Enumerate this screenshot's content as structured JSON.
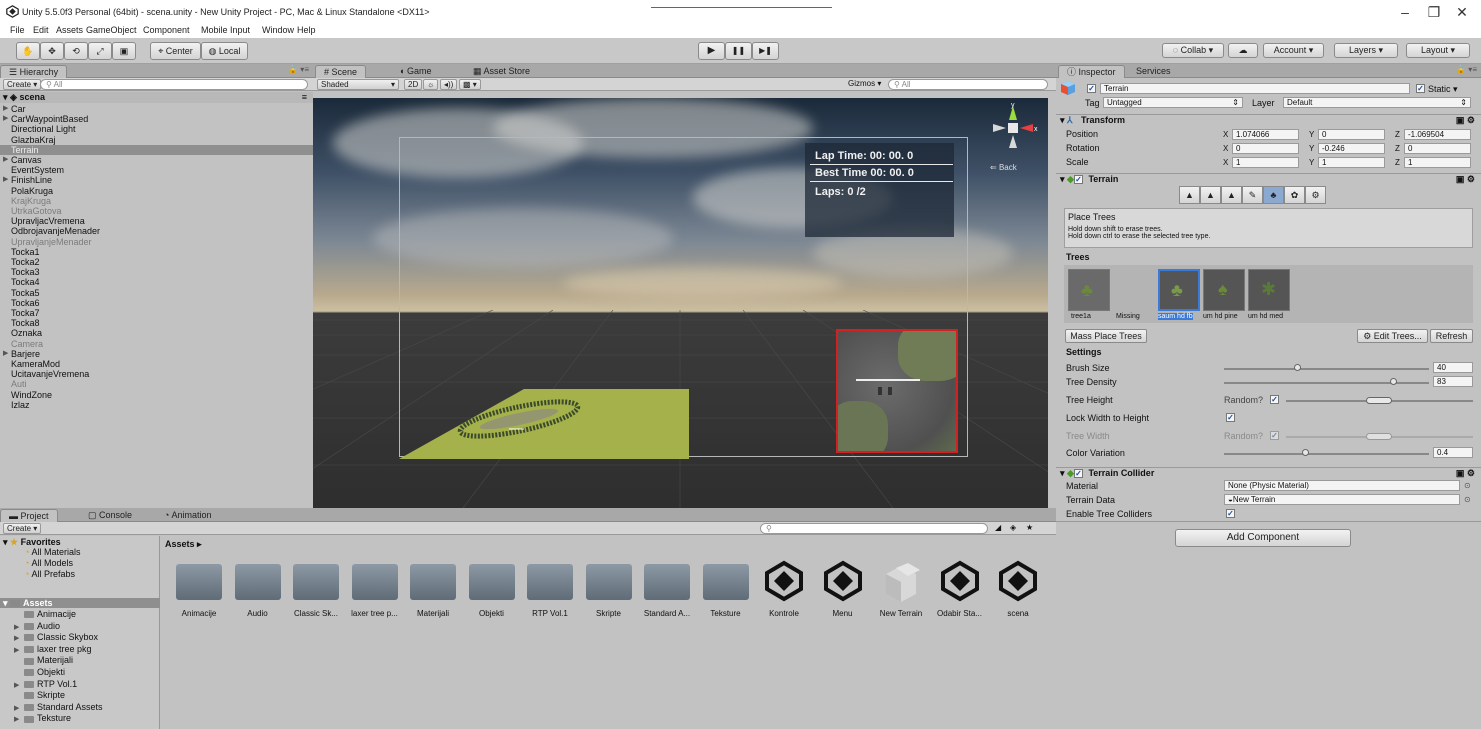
{
  "window": {
    "title": "Unity 5.5.0f3 Personal (64bit) - scena.unity - New Unity Project - PC, Mac & Linux Standalone <DX11>",
    "minimize": "–",
    "maximize": "❐",
    "close": "✕"
  },
  "menu": [
    "File",
    "Edit",
    "Assets",
    "GameObject",
    "Component",
    "Mobile Input",
    "Window",
    "Help"
  ],
  "toolbar": {
    "tools": [
      "✋",
      "✥",
      "⟲",
      "⤢",
      "▣"
    ],
    "pivot": "Center",
    "space": "Local",
    "play": "▶",
    "pause": "❚❚",
    "step": "▶❚",
    "collab": "Collab",
    "cloud": "☁",
    "account": "Account",
    "layers": "Layers",
    "layout": "Layout"
  },
  "hierarchy": {
    "tab": "Hierarchy",
    "create": "Create",
    "search_placeholder": "All",
    "scene": "scena",
    "items": [
      {
        "label": "Car",
        "arrow": true,
        "grey": false
      },
      {
        "label": "CarWaypointBased",
        "arrow": true,
        "grey": false
      },
      {
        "label": "Directional Light",
        "arrow": false,
        "grey": false
      },
      {
        "label": "GlazbaKraj",
        "arrow": false,
        "grey": false
      },
      {
        "label": "Terrain",
        "arrow": false,
        "grey": false,
        "selected": true
      },
      {
        "label": "Canvas",
        "arrow": true,
        "grey": false
      },
      {
        "label": "EventSystem",
        "arrow": false,
        "grey": false
      },
      {
        "label": "FinishLine",
        "arrow": true,
        "grey": false
      },
      {
        "label": "PolaKruga",
        "arrow": false,
        "grey": false
      },
      {
        "label": "KrajKruga",
        "arrow": false,
        "grey": true
      },
      {
        "label": "UtrkaGotova",
        "arrow": false,
        "grey": true
      },
      {
        "label": "UpravljacVremena",
        "arrow": false,
        "grey": false
      },
      {
        "label": "OdbrojavanjeMenader",
        "arrow": false,
        "grey": false
      },
      {
        "label": "UpravljanjeMenader",
        "arrow": false,
        "grey": true
      },
      {
        "label": "Tocka1",
        "arrow": false,
        "grey": false
      },
      {
        "label": "Tocka2",
        "arrow": false,
        "grey": false
      },
      {
        "label": "Tocka3",
        "arrow": false,
        "grey": false
      },
      {
        "label": "Tocka4",
        "arrow": false,
        "grey": false
      },
      {
        "label": "Tocka5",
        "arrow": false,
        "grey": false
      },
      {
        "label": "Tocka6",
        "arrow": false,
        "grey": false
      },
      {
        "label": "Tocka7",
        "arrow": false,
        "grey": false
      },
      {
        "label": "Tocka8",
        "arrow": false,
        "grey": false
      },
      {
        "label": "Oznaka",
        "arrow": false,
        "grey": false
      },
      {
        "label": "Camera",
        "arrow": false,
        "grey": true
      },
      {
        "label": "Barjere",
        "arrow": true,
        "grey": false
      },
      {
        "label": "KameraMod",
        "arrow": false,
        "grey": false
      },
      {
        "label": "UcitavanjeVremena",
        "arrow": false,
        "grey": false
      },
      {
        "label": "Auti",
        "arrow": false,
        "grey": true
      },
      {
        "label": "WindZone",
        "arrow": false,
        "grey": false
      },
      {
        "label": "Izlaz",
        "arrow": false,
        "grey": false
      }
    ]
  },
  "scene_tabs": {
    "scene": "Scene",
    "game": "Game",
    "asset_store": "Asset Store",
    "shaded": "Shaded",
    "mode2d": "2D",
    "gizmos": "Gizmos",
    "search_placeholder": "All",
    "back": "Back",
    "y_axis": "y",
    "x_axis": "x"
  },
  "hud": {
    "lap_time": "Lap Time:  00: 00. 0",
    "best_time": "Best Time  00: 00. 0",
    "laps": "Laps:   0 /2"
  },
  "inspector": {
    "tab": "Inspector",
    "services_tab": "Services",
    "object_name": "Terrain",
    "static_label": "Static",
    "tag_label": "Tag",
    "tag_value": "Untagged",
    "layer_label": "Layer",
    "layer_value": "Default",
    "transform": {
      "title": "Transform",
      "position_label": "Position",
      "rotation_label": "Rotation",
      "scale_label": "Scale",
      "position": {
        "x": "1.074066",
        "y": "0",
        "z": "-1.069504"
      },
      "rotation": {
        "x": "0",
        "y": "-0.246",
        "z": "0"
      },
      "scale": {
        "x": "1",
        "y": "1",
        "z": "1"
      }
    },
    "terrain": {
      "title": "Terrain",
      "help_title": "Place Trees",
      "help_line1": "Hold down shift to erase trees.",
      "help_line2": "Hold down ctrl to erase the selected tree type.",
      "trees_heading": "Trees",
      "tree_labels": [
        "tree1a",
        "Missing",
        "saum hd fb",
        "um hd pine",
        "um hd med"
      ],
      "mass_place": "Mass Place Trees",
      "edit_trees": "Edit Trees...",
      "refresh": "Refresh",
      "settings_heading": "Settings",
      "brush_size_label": "Brush Size",
      "brush_size": "40",
      "brush_size_fraction": 0.36,
      "density_label": "Tree Density",
      "density": "83",
      "density_fraction": 0.83,
      "height_label": "Tree Height",
      "random_label": "Random?",
      "lock_label": "Lock Width to Height",
      "width_label": "Tree Width",
      "color_var_label": "Color Variation",
      "color_var": "0.4",
      "color_var_fraction": 0.4
    },
    "collider": {
      "title": "Terrain Collider",
      "material_label": "Material",
      "material_value": "None (Physic Material)",
      "data_label": "Terrain Data",
      "data_value": "New Terrain",
      "enable_label": "Enable Tree Colliders"
    },
    "add_component": "Add Component"
  },
  "project": {
    "tab_project": "Project",
    "tab_console": "Console",
    "tab_animation": "Animation",
    "create": "Create",
    "favorites": "Favorites",
    "fav_items": [
      "All Materials",
      "All Models",
      "All Prefabs"
    ],
    "assets_root": "Assets",
    "breadcrumb": "Assets",
    "tree_items": [
      {
        "label": "Animacije",
        "arrow": false
      },
      {
        "label": "Audio",
        "arrow": true
      },
      {
        "label": "Classic Skybox",
        "arrow": true
      },
      {
        "label": "laxer tree pkg",
        "arrow": true
      },
      {
        "label": "Materijali",
        "arrow": false
      },
      {
        "label": "Objekti",
        "arrow": false
      },
      {
        "label": "RTP Vol.1",
        "arrow": true
      },
      {
        "label": "Skripte",
        "arrow": false
      },
      {
        "label": "Standard Assets",
        "arrow": true
      },
      {
        "label": "Teksture",
        "arrow": true
      }
    ],
    "grid_items": [
      {
        "label": "Animacije",
        "kind": "folder"
      },
      {
        "label": "Audio",
        "kind": "folder"
      },
      {
        "label": "Classic Sk...",
        "kind": "folder"
      },
      {
        "label": "laxer tree p...",
        "kind": "folder"
      },
      {
        "label": "Materijali",
        "kind": "folder"
      },
      {
        "label": "Objekti",
        "kind": "folder"
      },
      {
        "label": "RTP Vol.1",
        "kind": "folder"
      },
      {
        "label": "Skripte",
        "kind": "folder"
      },
      {
        "label": "Standard A...",
        "kind": "folder"
      },
      {
        "label": "Teksture",
        "kind": "folder"
      },
      {
        "label": "Kontrole",
        "kind": "unity"
      },
      {
        "label": "Menu",
        "kind": "unity"
      },
      {
        "label": "New Terrain",
        "kind": "terrain"
      },
      {
        "label": "Odabir Sta...",
        "kind": "unity"
      },
      {
        "label": "scena",
        "kind": "unity"
      }
    ]
  }
}
